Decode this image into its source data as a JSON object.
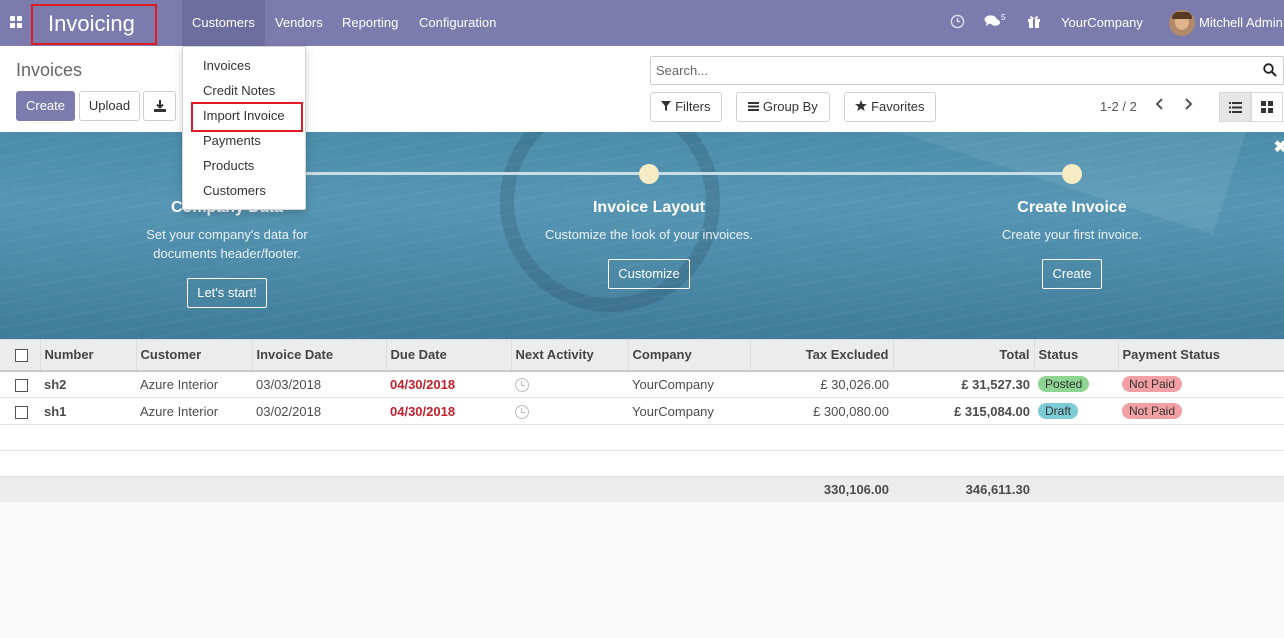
{
  "navbar": {
    "app_title": "Invoicing",
    "menu": [
      "Customers",
      "Vendors",
      "Reporting",
      "Configuration"
    ],
    "messages_count": "5",
    "company": "YourCompany",
    "user": "Mitchell Admin"
  },
  "dropdown": {
    "items": [
      "Invoices",
      "Credit Notes",
      "Import Invoice",
      "Payments",
      "Products",
      "Customers"
    ]
  },
  "control_panel": {
    "breadcrumb": "Invoices",
    "create_label": "Create",
    "upload_label": "Upload",
    "search_placeholder": "Search...",
    "filters_label": "Filters",
    "group_by_label": "Group By",
    "favorites_label": "Favorites",
    "pager": "1-2 / 2"
  },
  "banner": {
    "steps": [
      {
        "title": "Company Data",
        "desc_line1": "Set your company's data for",
        "desc_line2": "documents header/footer.",
        "button": "Let's start!"
      },
      {
        "title": "Invoice Layout",
        "desc_line1": "Customize the look of your invoices.",
        "desc_line2": "",
        "button": "Customize"
      },
      {
        "title": "Create Invoice",
        "desc_line1": "Create your first invoice.",
        "desc_line2": "",
        "button": "Create"
      }
    ]
  },
  "table": {
    "columns": [
      "Number",
      "Customer",
      "Invoice Date",
      "Due Date",
      "Next Activity",
      "Company",
      "Tax Excluded",
      "Total",
      "Status",
      "Payment Status"
    ],
    "rows": [
      {
        "number": "sh2",
        "customer": "Azure Interior",
        "invoice_date": "03/03/2018",
        "due_date": "04/30/2018",
        "company": "YourCompany",
        "tax_excluded": "£ 30,026.00",
        "total": "£ 31,527.30",
        "status": "Posted",
        "payment_status": "Not Paid"
      },
      {
        "number": "sh1",
        "customer": "Azure Interior",
        "invoice_date": "03/02/2018",
        "due_date": "04/30/2018",
        "company": "YourCompany",
        "tax_excluded": "£ 300,080.00",
        "total": "£ 315,084.00",
        "status": "Draft",
        "payment_status": "Not Paid"
      }
    ],
    "totals": {
      "tax_excluded": "330,106.00",
      "total": "346,611.30"
    }
  },
  "colors": {
    "brand": "#7c7bad",
    "due_date": "#c0212b",
    "posted": "#8ed492",
    "draft": "#7dcbd6",
    "not_paid": "#f2a0a4"
  }
}
